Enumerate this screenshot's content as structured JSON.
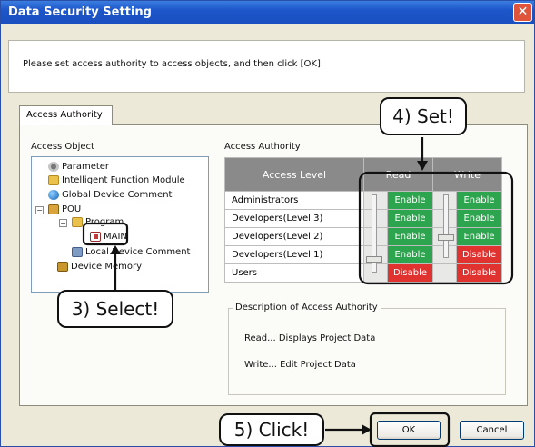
{
  "window": {
    "title": "Data Security Setting",
    "close_glyph": "✕"
  },
  "instruction": "Please set access authority to access objects, and then click [OK].",
  "tab": {
    "label": "Access Authority"
  },
  "access_object": {
    "label": "Access Object",
    "items": [
      {
        "label": "Parameter",
        "icon": "gear-icon"
      },
      {
        "label": "Intelligent Function Module",
        "icon": "folder-icon"
      },
      {
        "label": "Global Device Comment",
        "icon": "globe-icon"
      },
      {
        "label": "POU",
        "icon": "pou-icon"
      },
      {
        "label": "Program",
        "icon": "folder-icon"
      },
      {
        "label": "MAIN",
        "icon": "program-icon"
      },
      {
        "label": "Local Device Comment",
        "icon": "doc-icon"
      },
      {
        "label": "Device Memory",
        "icon": "memory-icon"
      }
    ],
    "expanders": [
      "−",
      "−"
    ]
  },
  "access_authority": {
    "label": "Access Authority",
    "columns": {
      "level": "Access Level",
      "read": "Read",
      "write": "Write"
    },
    "rows": [
      {
        "level": "Administrators",
        "read": "Enable",
        "write": "Enable"
      },
      {
        "level": "Developers(Level 3)",
        "read": "Enable",
        "write": "Enable"
      },
      {
        "level": "Developers(Level 2)",
        "read": "Enable",
        "write": "Enable"
      },
      {
        "level": "Developers(Level 1)",
        "read": "Enable",
        "write": "Disable"
      },
      {
        "level": "Users",
        "read": "Disable",
        "write": "Disable"
      }
    ],
    "read_slider_level": "Developers(Level 1)",
    "write_slider_level": "Developers(Level 2)"
  },
  "description": {
    "title": "Description of Access Authority",
    "read_line": "Read...   Displays Project Data",
    "write_line": "Write...   Edit Project Data"
  },
  "buttons": {
    "ok": "OK",
    "cancel": "Cancel"
  },
  "callouts": {
    "select": "3) Select!",
    "set": "4) Set!",
    "click": "5) Click!"
  },
  "colors": {
    "enable": "#2da44e",
    "disable": "#e0322f",
    "title_bar": "#1d56c9"
  }
}
